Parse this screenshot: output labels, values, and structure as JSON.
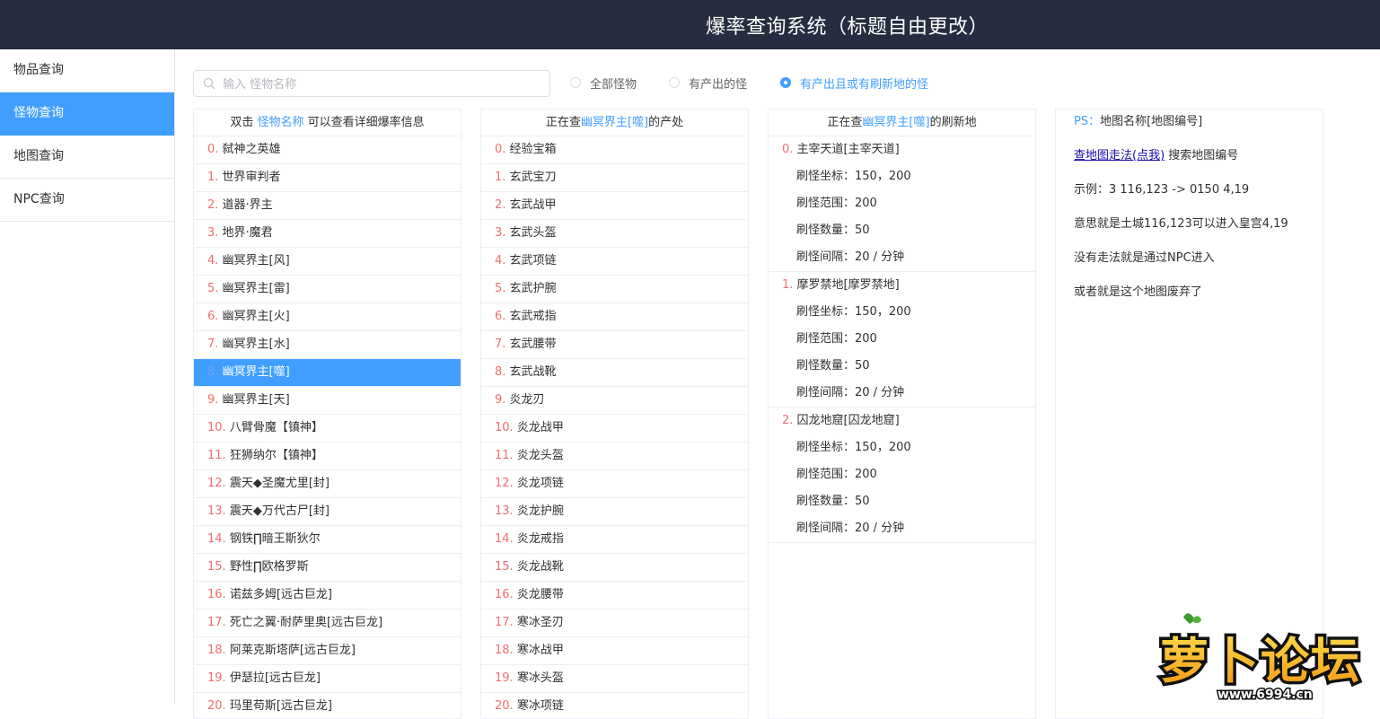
{
  "header": {
    "title": "爆率查询系统（标题自由更改）"
  },
  "sidebar": {
    "items": [
      {
        "label": "物品查询",
        "active": false
      },
      {
        "label": "怪物查询",
        "active": true
      },
      {
        "label": "地图查询",
        "active": false
      },
      {
        "label": "NPC查询",
        "active": false
      }
    ]
  },
  "search": {
    "placeholder": "输入 怪物名称",
    "value": ""
  },
  "filters": {
    "options": [
      "全部怪物",
      "有产出的怪",
      "有产出且或有刷新地的怪"
    ],
    "selected": "有产出且或有刷新地的怪"
  },
  "monster_panel": {
    "header_prefix": "双击",
    "header_link": "怪物名称",
    "header_suffix": "可以查看详细爆率信息",
    "selected_index": 8,
    "items": [
      {
        "idx": "0.",
        "name": "弑神之英雄"
      },
      {
        "idx": "1.",
        "name": "世界审判者"
      },
      {
        "idx": "2.",
        "name": "道器·界主"
      },
      {
        "idx": "3.",
        "name": "地界·魔君"
      },
      {
        "idx": "4.",
        "name": "幽冥界主[风]"
      },
      {
        "idx": "5.",
        "name": "幽冥界主[雷]"
      },
      {
        "idx": "6.",
        "name": "幽冥界主[火]"
      },
      {
        "idx": "7.",
        "name": "幽冥界主[水]"
      },
      {
        "idx": "8.",
        "name": "幽冥界主[噬]"
      },
      {
        "idx": "9.",
        "name": "幽冥界主[天]"
      },
      {
        "idx": "10.",
        "name": "八臂骨魔【镇神】"
      },
      {
        "idx": "11.",
        "name": "狂狮纳尔【镇神】"
      },
      {
        "idx": "12.",
        "name": "震天◆圣魔尤里[封]"
      },
      {
        "idx": "13.",
        "name": "震天◆万代古尸[封]"
      },
      {
        "idx": "14.",
        "name": "钢铁∏暗王斯狄尔"
      },
      {
        "idx": "15.",
        "name": "野性∏欧格罗斯"
      },
      {
        "idx": "16.",
        "name": "诺兹多姆[远古巨龙]"
      },
      {
        "idx": "17.",
        "name": "死亡之翼·耐萨里奥[远古巨龙]"
      },
      {
        "idx": "18.",
        "name": "阿莱克斯塔萨[远古巨龙]"
      },
      {
        "idx": "19.",
        "name": "伊瑟拉[远古巨龙]"
      },
      {
        "idx": "20.",
        "name": "玛里苟斯[远古巨龙]"
      }
    ]
  },
  "drop_panel": {
    "header_prefix": "正在查",
    "header_target": "幽冥界主[噬]",
    "header_suffix": "的产处",
    "items": [
      {
        "idx": "0.",
        "name": "经验宝箱"
      },
      {
        "idx": "1.",
        "name": "玄武宝刀"
      },
      {
        "idx": "2.",
        "name": "玄武战甲"
      },
      {
        "idx": "3.",
        "name": "玄武头盔"
      },
      {
        "idx": "4.",
        "name": "玄武项链"
      },
      {
        "idx": "5.",
        "name": "玄武护腕"
      },
      {
        "idx": "6.",
        "name": "玄武戒指"
      },
      {
        "idx": "7.",
        "name": "玄武腰带"
      },
      {
        "idx": "8.",
        "name": "玄武战靴"
      },
      {
        "idx": "9.",
        "name": "炎龙刃"
      },
      {
        "idx": "10.",
        "name": "炎龙战甲"
      },
      {
        "idx": "11.",
        "name": "炎龙头盔"
      },
      {
        "idx": "12.",
        "name": "炎龙项链"
      },
      {
        "idx": "13.",
        "name": "炎龙护腕"
      },
      {
        "idx": "14.",
        "name": "炎龙戒指"
      },
      {
        "idx": "15.",
        "name": "炎龙战靴"
      },
      {
        "idx": "16.",
        "name": "炎龙腰带"
      },
      {
        "idx": "17.",
        "name": "寒冰圣刃"
      },
      {
        "idx": "18.",
        "name": "寒冰战甲"
      },
      {
        "idx": "19.",
        "name": "寒冰头盔"
      },
      {
        "idx": "20.",
        "name": "寒冰项链"
      }
    ]
  },
  "spawn_panel": {
    "header_prefix": "正在查",
    "header_target": "幽冥界主[噬]",
    "header_suffix": "的刷新地",
    "locations": [
      {
        "idx": "0.",
        "name": "主宰天道[主宰天道]",
        "coords": "刷怪坐标：150，200",
        "range": "刷怪范围：200",
        "count": "刷怪数量：50",
        "interval": "刷怪间隔：20 / 分钟"
      },
      {
        "idx": "1.",
        "name": "摩罗禁地[摩罗禁地]",
        "coords": "刷怪坐标：150，200",
        "range": "刷怪范围：200",
        "count": "刷怪数量：50",
        "interval": "刷怪间隔：20 / 分钟"
      },
      {
        "idx": "2.",
        "name": "囚龙地窟[囚龙地窟]",
        "coords": "刷怪坐标：150，200",
        "range": "刷怪范围：200",
        "count": "刷怪数量：50",
        "interval": "刷怪间隔：20 / 分钟"
      }
    ]
  },
  "info_panel": {
    "ps_label": "PS：",
    "ps_text": "地图名称[地图编号]",
    "link_text": "查地图走法(点我)",
    "link_suffix": " 搜索地图编号",
    "example": "示例：3 116,123 -> 0150 4,19",
    "meaning": "意思就是土城116,123可以进入皇宫4,19",
    "no_route": "没有走法就是通过NPC进入",
    "abandoned": "或者就是这个地图废弃了"
  },
  "watermark": {
    "text": "萝卜论坛",
    "url_text": "www.6994.cn"
  },
  "colors": {
    "header_bg": "#262d40",
    "accent": "#409eff",
    "index_red": "#f56c6c"
  }
}
